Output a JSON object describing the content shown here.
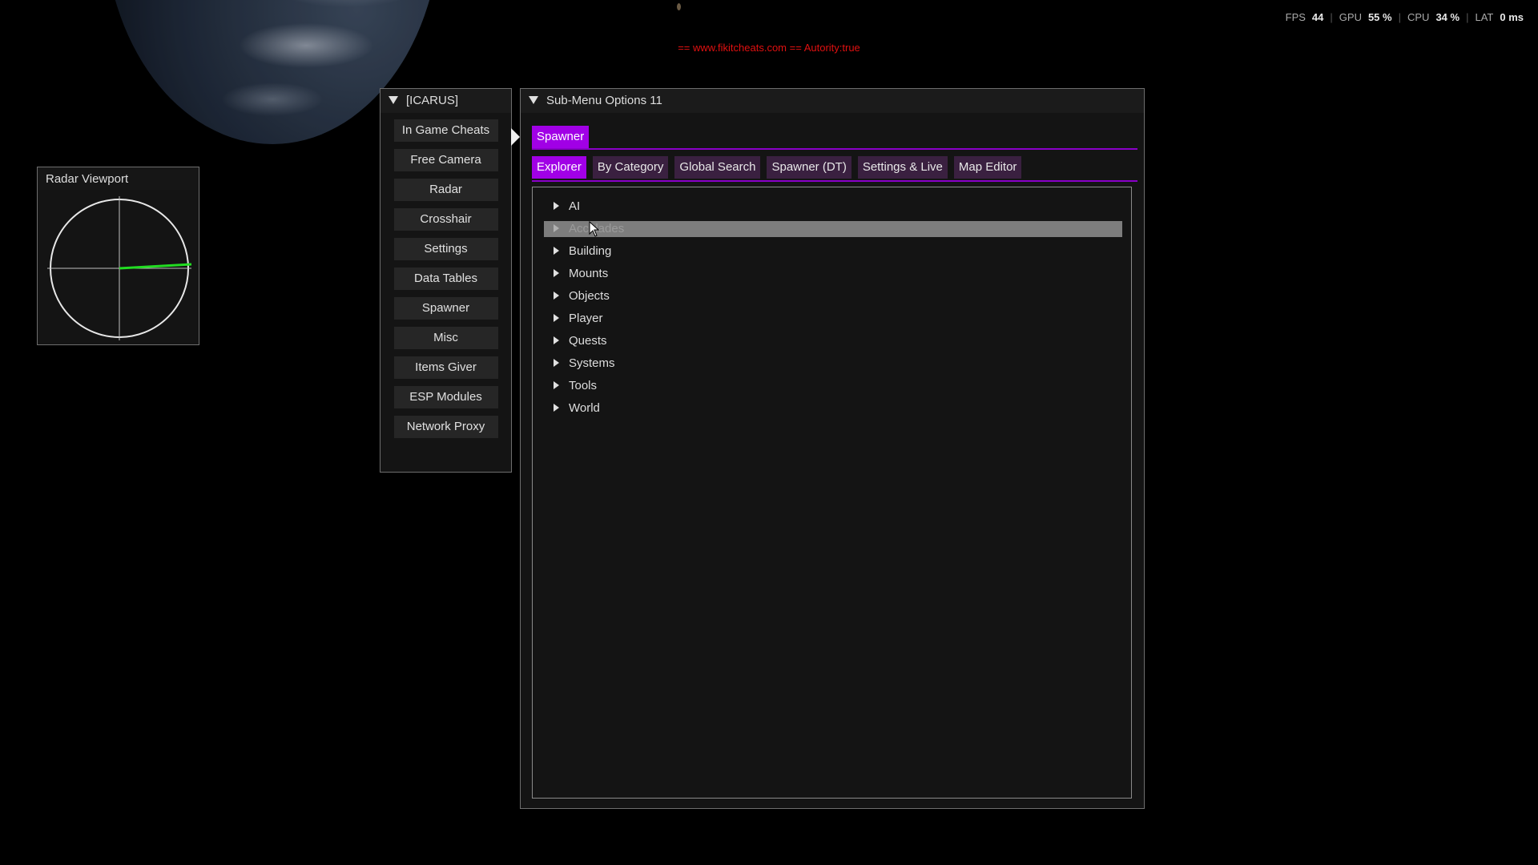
{
  "perf": {
    "fps_label": "FPS",
    "fps_value": "44",
    "gpu_label": "GPU",
    "gpu_value": "55 %",
    "cpu_label": "CPU",
    "cpu_value": "34 %",
    "lat_label": "LAT",
    "lat_value": "0 ms"
  },
  "watermark": "== www.fikitcheats.com == Autority:true",
  "radar": {
    "title": "Radar Viewport"
  },
  "menu": {
    "title": "[ICARUS]",
    "items": [
      {
        "label": "In Game Cheats"
      },
      {
        "label": "Free Camera"
      },
      {
        "label": "Radar"
      },
      {
        "label": "Crosshair"
      },
      {
        "label": "Settings"
      },
      {
        "label": "Data Tables"
      },
      {
        "label": "Spawner"
      },
      {
        "label": "Misc"
      },
      {
        "label": "Items Giver"
      },
      {
        "label": "ESP Modules"
      },
      {
        "label": "Network Proxy"
      }
    ]
  },
  "submenu": {
    "title": "Sub-Menu Options 11",
    "top_tab": "Spawner",
    "tabs": [
      {
        "label": "Explorer",
        "active": true
      },
      {
        "label": "By Category"
      },
      {
        "label": "Global Search"
      },
      {
        "label": "Spawner (DT)"
      },
      {
        "label": "Settings & Live"
      },
      {
        "label": "Map Editor"
      }
    ],
    "tree": [
      {
        "label": "AI"
      },
      {
        "label": "Accolades",
        "hovered": true
      },
      {
        "label": "Building"
      },
      {
        "label": "Mounts"
      },
      {
        "label": "Objects"
      },
      {
        "label": "Player"
      },
      {
        "label": "Quests"
      },
      {
        "label": "Systems"
      },
      {
        "label": "Tools"
      },
      {
        "label": "World"
      }
    ]
  },
  "colors": {
    "accent": "#a100e6",
    "tab_inactive": "#3a2040",
    "radar_heading": "#22dd22",
    "watermark": "#e01010"
  }
}
